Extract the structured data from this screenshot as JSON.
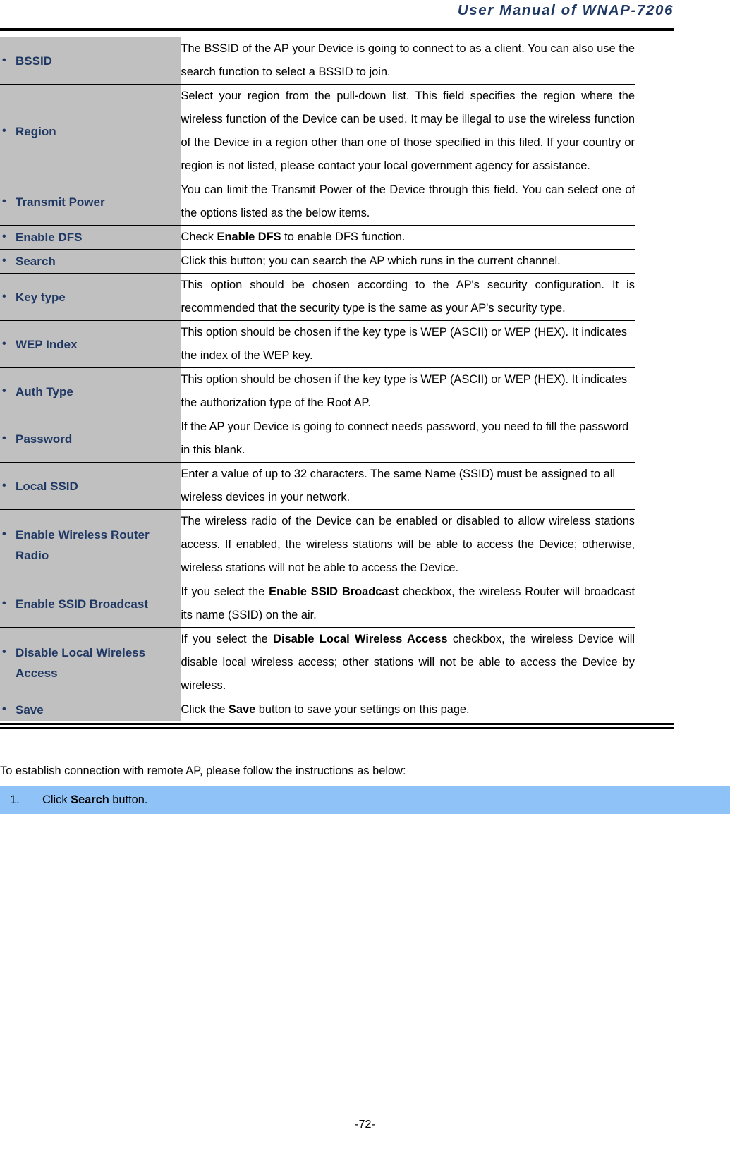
{
  "header": {
    "title": "User Manual of WNAP-7206"
  },
  "table": {
    "rows": [
      {
        "label": "BSSID",
        "desc_html": "The BSSID of the AP your Device is going to connect to as a client. You can also use the search function to select a BSSID to join.",
        "desc": "The BSSID of the AP your Device is going to connect to as a client. You can also use the search function to select a BSSID to join."
      },
      {
        "label": "Region",
        "desc": "Select your region from the pull-down list. This field specifies the region where the wireless function of the Device can be used. It may be illegal to use the wireless function of the Device in a region other than one of those specified in this filed. If your country or region is not listed, please contact your local government agency for assistance."
      },
      {
        "label": "Transmit Power",
        "desc": "You can limit the Transmit Power of the Device through this field. You can select one of the options listed as the below items."
      },
      {
        "label": "Enable DFS",
        "desc_pre": "Check ",
        "desc_bold": "Enable DFS",
        "desc_post": " to enable DFS function."
      },
      {
        "label": "Search",
        "desc": "Click this button; you can search the AP which runs in the current channel."
      },
      {
        "label": "Key type",
        "desc": "This option should be chosen according to the AP's security configuration. It is recommended that the security type is the same as your AP's security type."
      },
      {
        "label": "WEP Index",
        "desc": "This option should be chosen if the key type is WEP (ASCII) or WEP (HEX). It indicates the index of the WEP key."
      },
      {
        "label": "Auth Type",
        "desc": "This option should be chosen if the key type is WEP (ASCII) or WEP (HEX). It indicates the authorization type of the Root AP."
      },
      {
        "label": "Password",
        "desc": "If the AP your Device is going to connect needs password, you need to fill the password in this blank."
      },
      {
        "label": "Local SSID",
        "desc": "Enter a value of up to 32 characters. The same Name (SSID) must be assigned to all wireless devices in your network."
      },
      {
        "label": "Enable Wireless Router Radio",
        "desc": "The wireless radio of the Device can be enabled or disabled to allow wireless stations access. If enabled, the wireless stations will be able to access the Device; otherwise, wireless stations will not be able to access the Device."
      },
      {
        "label": "Enable SSID Broadcast",
        "desc_pre": "If you select the ",
        "desc_bold": "Enable SSID Broadcast",
        "desc_post": " checkbox, the wireless Router will broadcast its name (SSID) on the air."
      },
      {
        "label": "Disable Local Wireless Access",
        "desc_pre": "If you select the ",
        "desc_bold": "Disable Local Wireless Access",
        "desc_post": " checkbox, the wireless Device will disable local wireless access; other stations will not be able to access the Device by wireless."
      },
      {
        "label": "Save",
        "desc_pre": "Click the ",
        "desc_bold": "Save",
        "desc_post": " button to save your settings on this page."
      }
    ]
  },
  "body": {
    "intro": "To establish connection with remote AP, please follow the instructions as below:",
    "step_number": "1.",
    "step_pre": "Click ",
    "step_bold": "Search",
    "step_post": " button."
  },
  "footer": {
    "page_number": "-72-"
  },
  "colors": {
    "accent_navy": "#1F3864",
    "label_cell_gray": "#C0C0C0",
    "highlight_blue": "#8FC3F8"
  }
}
